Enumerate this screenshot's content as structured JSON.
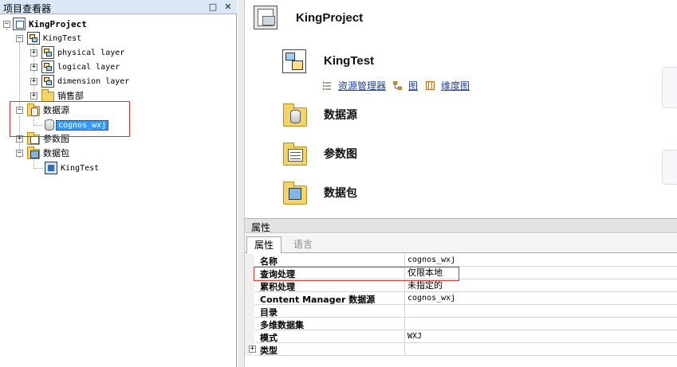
{
  "project_viewer": {
    "title": "项目查看器",
    "controls": {
      "restore": "□",
      "close": "✕"
    },
    "tree": {
      "root": "KingProject",
      "model": "KingTest",
      "layers": [
        "physical layer",
        "logical layer",
        "dimension layer"
      ],
      "sales_folder": "销售部",
      "data_sources_folder": "数据源",
      "data_source": "cognos_wxj",
      "parameter_maps_folder": "参数图",
      "packages_folder": "数据包",
      "package": "KingTest"
    }
  },
  "overview": {
    "project_title": "KingProject",
    "model_title": "KingTest",
    "model_links": [
      "资源管理器",
      "图",
      "维度图"
    ],
    "sections": [
      "数据源",
      "参数图",
      "数据包"
    ]
  },
  "properties": {
    "panel_title": "属性",
    "tabs": [
      "属性",
      "语言"
    ],
    "rows": [
      {
        "name": "名称",
        "value": "cognos_wxj"
      },
      {
        "name": "查询处理",
        "value": "仅限本地"
      },
      {
        "name": "累积处理",
        "value": "未指定的"
      },
      {
        "name": "Content Manager 数据源",
        "value": "cognos_wxj"
      },
      {
        "name": "目录",
        "value": ""
      },
      {
        "name": "多维数据集",
        "value": ""
      },
      {
        "name": "模式",
        "value": "WXJ"
      },
      {
        "name": "类型",
        "value": ""
      }
    ]
  },
  "colors": {
    "selection": "#3399ff",
    "highlight_box": "#e03030",
    "link": "#1c3fa8",
    "folder": "#f3d46a"
  }
}
